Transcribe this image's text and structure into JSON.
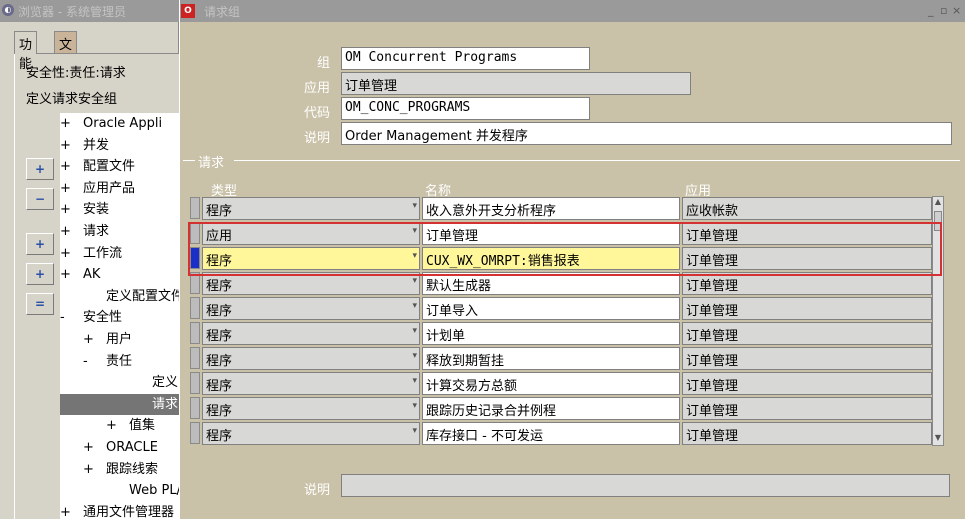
{
  "nav": {
    "title": "浏览器 - 系统管理员",
    "tabs": [
      "功能",
      "文档"
    ],
    "security_label": "安全性:责任:请求",
    "define_label": "定义请求安全组",
    "buttons": {
      "expand": "+",
      "collapse": "−",
      "expand_branch": "+",
      "expand_all": "+",
      "collapse_all": "="
    },
    "tree": [
      {
        "pm": "+",
        "label": "Oracle Appli",
        "indent": 0
      },
      {
        "pm": "+",
        "label": "并发",
        "indent": 0
      },
      {
        "pm": "+",
        "label": "配置文件",
        "indent": 0
      },
      {
        "pm": "+",
        "label": "应用产品",
        "indent": 0
      },
      {
        "pm": "+",
        "label": "安装",
        "indent": 0
      },
      {
        "pm": "+",
        "label": "请求",
        "indent": 0
      },
      {
        "pm": "+",
        "label": "工作流",
        "indent": 0
      },
      {
        "pm": "+",
        "label": "AK",
        "indent": 0
      },
      {
        "pm": "",
        "label": "定义配置文件",
        "indent": 1
      },
      {
        "pm": "-",
        "label": "安全性",
        "indent": 0
      },
      {
        "pm": "+",
        "label": "用户",
        "indent": 1
      },
      {
        "pm": "-",
        "label": "责任",
        "indent": 1
      },
      {
        "pm": "",
        "label": "定义",
        "indent": 3
      },
      {
        "pm": "",
        "label": "请求",
        "indent": 3,
        "selected": true
      },
      {
        "pm": "+",
        "label": "值集",
        "indent": 2
      },
      {
        "pm": "+",
        "label": "ORACLE",
        "indent": 1
      },
      {
        "pm": "+",
        "label": "跟踪线索",
        "indent": 1
      },
      {
        "pm": "",
        "label": "Web PL/S",
        "indent": 2
      },
      {
        "pm": "+",
        "label": "通用文件管理器",
        "indent": 0
      }
    ]
  },
  "form": {
    "title": "请求组",
    "labels": {
      "group": "组",
      "app": "应用",
      "code": "代码",
      "desc": "说明"
    },
    "values": {
      "group": "OM Concurrent Programs",
      "app": "订单管理",
      "code": "OM_CONC_PROGRAMS",
      "desc": "Order Management 并发程序"
    },
    "section_title": "请求",
    "columns": {
      "type": "类型",
      "name": "名称",
      "app": "应用"
    },
    "rows": [
      {
        "type": "程序",
        "name": "收入意外开支分析程序",
        "app": "应收帐款",
        "current": false
      },
      {
        "type": "应用",
        "name": "订单管理",
        "app": "订单管理",
        "current": false
      },
      {
        "type": "程序",
        "name": "CUX_WX_OMRPT:销售报表",
        "app": "订单管理",
        "current": true
      },
      {
        "type": "程序",
        "name": "默认生成器",
        "app": "订单管理",
        "current": false
      },
      {
        "type": "程序",
        "name": "订单导入",
        "app": "订单管理",
        "current": false
      },
      {
        "type": "程序",
        "name": "计划单",
        "app": "订单管理",
        "current": false
      },
      {
        "type": "程序",
        "name": "释放到期暂挂",
        "app": "订单管理",
        "current": false
      },
      {
        "type": "程序",
        "name": "计算交易方总额",
        "app": "订单管理",
        "current": false
      },
      {
        "type": "程序",
        "name": "跟踪历史记录合并例程",
        "app": "订单管理",
        "current": false
      },
      {
        "type": "程序",
        "name": "库存接口 - 不可发运",
        "app": "订单管理",
        "current": false
      }
    ],
    "footer_label": "说明",
    "footer_value": ""
  },
  "colors": {
    "current_row": "#fff79a",
    "highlight_border": "#d43232",
    "indicator": "#1a2fc8"
  }
}
